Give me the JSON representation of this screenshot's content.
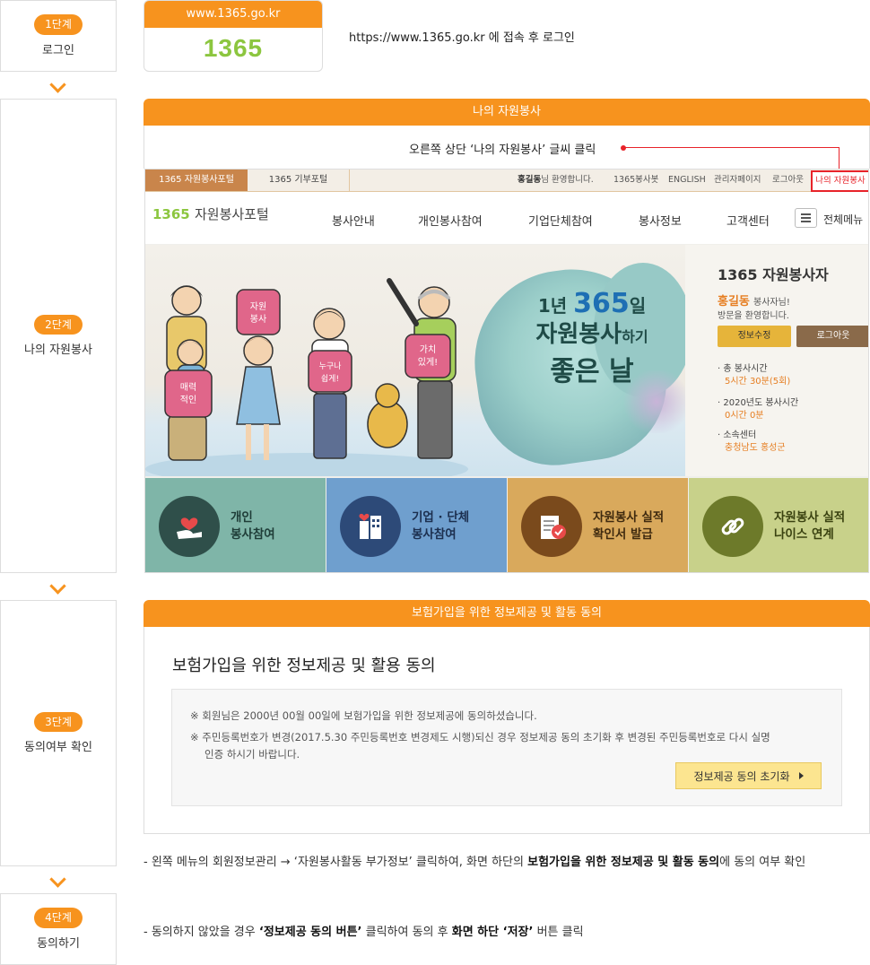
{
  "steps": [
    {
      "badge": "1단계",
      "label": "로그인"
    },
    {
      "badge": "2단계",
      "label": "나의 자원봉사"
    },
    {
      "badge": "3단계",
      "label": "동의여부 확인"
    },
    {
      "badge": "4단계",
      "label": "동의하기"
    }
  ],
  "step1": {
    "url_label": "www.1365.go.kr",
    "logo": "1365",
    "desc": "https://www.1365.go.kr 에 접속 후 로그인"
  },
  "step2": {
    "header": "나의 자원봉사",
    "instruction": "오른쪽 상단 ‘나의 자원봉사’ 글씨 클릭"
  },
  "portal": {
    "tabs": [
      "1365 자원봉사포털",
      "1365 기부포털"
    ],
    "welcome_name": "홍길동",
    "welcome_suffix": "님 환영합니다.",
    "util": [
      "1365봉사봇",
      "ENGLISH",
      "관리자페이지",
      "로그아웃"
    ],
    "my_volunteer": "나의 자원봉사",
    "logo_num": "1365",
    "logo_text": "자원봉사포털",
    "nav": [
      "봉사안내",
      "개인봉사참여",
      "기업단체참여",
      "봉사정보",
      "고객센터"
    ],
    "all_menu": "전체메뉴",
    "hero": {
      "line1a": "1년",
      "line1b": "365",
      "line1c": "일",
      "line2a": "자원봉사",
      "line2b": "하기",
      "line3": "좋은 날",
      "puzzle1": "자원\n봉사",
      "puzzle2": "매력\n적인",
      "puzzle3": "누구나\n쉽게!",
      "puzzle4": "가치\n있게!"
    },
    "panel": {
      "title": "1365 자원봉사자",
      "name": "홍길동",
      "name_suffix": "봉사자님!",
      "greet": "방문을 환영합니다.",
      "btn_edit": "정보수정",
      "btn_logout": "로그아웃",
      "stats": [
        {
          "label": "총 봉사시간",
          "value": "5시간 30분(5회)"
        },
        {
          "label": "2020년도 봉사시간",
          "value": "0시간 0분"
        },
        {
          "label": "소속센터",
          "value": "충청남도 홍성군"
        }
      ]
    },
    "tiles": [
      {
        "l1": "개인",
        "l2": "봉사참여",
        "color": "#7fb5a8"
      },
      {
        "l1": "기업 · 단체",
        "l2": "봉사참여",
        "color": "#6f9fce"
      },
      {
        "l1": "자원봉사 실적",
        "l2": "확인서 발급",
        "color": "#d9a95c"
      },
      {
        "l1": "자원봉사 실적",
        "l2": "나이스 연계",
        "color": "#c8d18a"
      }
    ]
  },
  "step3": {
    "header": "보험가입을 위한 정보제공 및 활동 동의",
    "title": "보험가입을 위한 정보제공 및 활용 동의",
    "note1_prefix": "회원님은 ",
    "note1_date": "2000년 00월 00일",
    "note1_suffix": "에 보험가입을 위한 정보제공에 동의하셨습니다.",
    "note2": "주민등록번호가 변경(2017.5.30 주민등록번호 변경제도 시행)되신 경우 정보제공 동의 초기화 후 변경된 주민등록번호로 다시 실명",
    "note2b": "인증 하시기 바랍니다.",
    "button": "정보제공 동의 초기화",
    "mark": "※"
  },
  "desc3": {
    "p1": "- 왼쪽 메뉴의 회원정보관리 → ‘자원봉사활동 부가정보’ 클릭하여, 화면 하단의 ",
    "b1": "보험가입을 위한 정보제공 및 활동 동의",
    "p2": "에 동의 여부 확인"
  },
  "desc4": {
    "p1": "- 동의하지 않았을 경우 ",
    "b1": "‘정보제공 동의 버튼’",
    "p2": " 클릭하여 동의 후 ",
    "b2": "화면 하단 ‘저장’",
    "p3": " 버튼 클릭"
  },
  "colors": {
    "accent": "#f7931e",
    "highlight": "#e8232a"
  }
}
